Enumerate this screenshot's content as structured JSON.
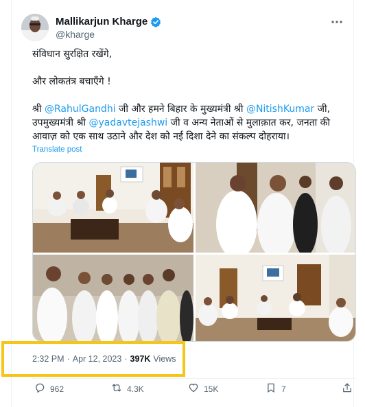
{
  "author": {
    "name": "Mallikarjun Kharge",
    "handle": "@kharge",
    "verified": true
  },
  "tweet": {
    "line1": "संविधान सुरक्षित रखेंगे,",
    "line2": "और लोकतंत्र बचाएँगे !",
    "p3_prefix": "श्री ",
    "mention1": "@RahulGandhi",
    "p3_mid1": " जी और हमने बिहार के मुख्यमंत्री श्री ",
    "mention2": "@NitishKumar",
    "p3_mid2": " जी,",
    "p4_prefix": "उपमुख्यमंत्री श्री ",
    "mention3": "@yadavtejashwi",
    "p4_rest": " जी व अन्य नेताओं से मुलाक़ात कर, जनता की",
    "p5": "आवाज़ को एक साथ उठाने और देश को नई दिशा देने का संकल्प दोहराया।",
    "translate_label": "Translate post"
  },
  "meta": {
    "time": "2:32 PM",
    "sep1": "·",
    "date": "Apr 12, 2023",
    "sep2": "·",
    "views_count": "397K",
    "views_label": "Views"
  },
  "actions": {
    "replies": "962",
    "reposts": "4.3K",
    "likes": "15K",
    "bookmarks": "7"
  },
  "icons": [
    "verified-badge-icon",
    "more-icon",
    "reply-icon",
    "repost-icon",
    "like-icon",
    "bookmark-icon",
    "share-icon"
  ],
  "colors": {
    "accent": "#1d9bf0",
    "secondary_text": "#536471",
    "highlight_box": "#f5c518"
  }
}
